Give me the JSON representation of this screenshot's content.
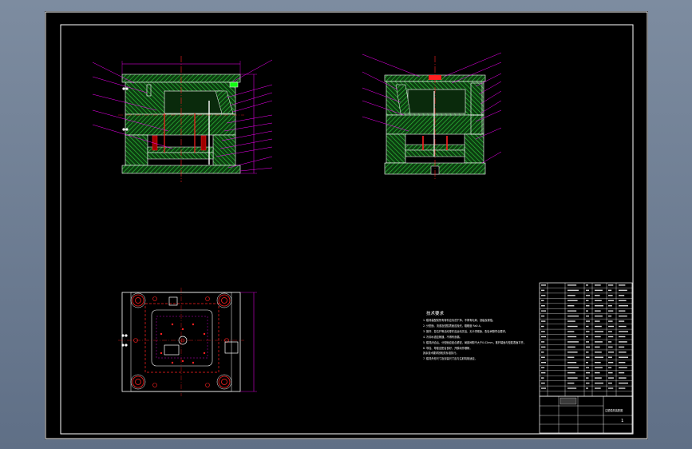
{
  "viewport": {
    "background_color": "#6f7f96",
    "paper_color": "#000000",
    "line_white": "#ffffff",
    "line_magenta": "#ff00ff",
    "line_red": "#ff2020",
    "hatch_green": "#1f9a2a",
    "accent_cyan": "#00c8ff"
  },
  "technical_notes": {
    "title": "技术要求",
    "items": [
      "1. 模具装配前所有零件应清洗干净，不得有毛刺、划痕及锈蚀。",
      "2. 分型面、流道及型腔表面应抛光，粗糙度 Ra0.4。",
      "3. 推杆、复位杆等活动零件应运动灵活，无卡滞现象，配合间隙符合要求。",
      "4. 冷却水道应畅通，不得有渗漏。",
      "5. 模具闭合后，分型面应贴合紧密，局部间隙不大于0.02mm，推杆端面与型腔表面平齐。",
      "6. 导柱、导套应配合良好，开模动作顺畅，",
      "   其余技术要求按相关标准执行。",
      "7. 模具外形尺寸及安装尺寸应与注射机相适应。"
    ]
  },
  "title_block": {
    "drawing_name": "注塑模具装配图",
    "sheet": "1"
  }
}
